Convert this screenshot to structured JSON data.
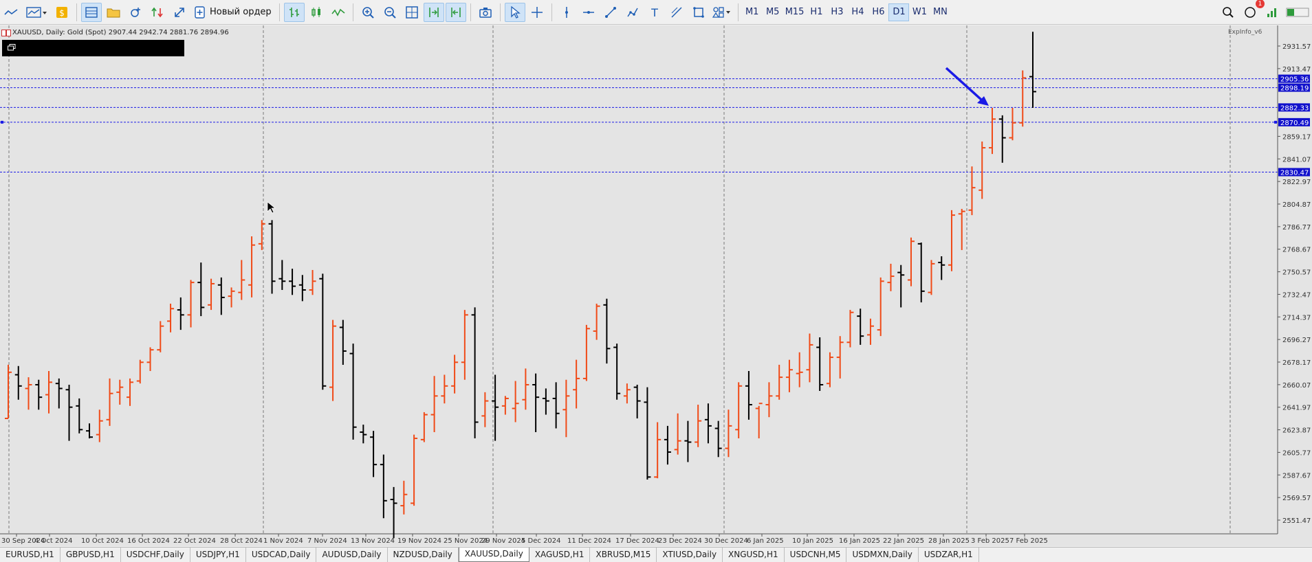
{
  "toolbar": {
    "new_order_label": "Новый ордер",
    "timeframes": [
      "M1",
      "M5",
      "M15",
      "H1",
      "H3",
      "H4",
      "H6",
      "D1",
      "W1",
      "MN"
    ],
    "active_timeframe": "D1",
    "notification_count": "1"
  },
  "chart": {
    "symbol_line": "XAUUSD, Daily:  Gold (Spot)  2907.44 2942.74 2881.76 2894.96",
    "indicator_label": "ExpInfo_v6",
    "colors": {
      "bull": "#f04a17",
      "bear": "#000000",
      "hline": "#1a1ae6",
      "background": "#e4e4e4"
    }
  },
  "chart_data": {
    "type": "ohlc",
    "symbol": "XAUUSD",
    "timeframe": "Daily",
    "ylim": [
      2540,
      2950
    ],
    "price_ticks": [
      "2931.57",
      "2913.47",
      "2859.17",
      "2841.07",
      "2822.97",
      "2804.87",
      "2786.77",
      "2768.67",
      "2750.57",
      "2732.47",
      "2714.37",
      "2696.27",
      "2678.17",
      "2660.07",
      "2641.97",
      "2623.87",
      "2605.77",
      "2587.67",
      "2569.57",
      "2551.47"
    ],
    "date_ticks": [
      "30 Sep 2024",
      "4 Oct 2024",
      "10 Oct 2024",
      "16 Oct 2024",
      "22 Oct 2024",
      "28 Oct 2024",
      "1 Nov 2024",
      "7 Nov 2024",
      "13 Nov 2024",
      "19 Nov 2024",
      "25 Nov 2024",
      "29 Nov 2024",
      "5 Dec 2024",
      "11 Dec 2024",
      "17 Dec 2024",
      "23 Dec 2024",
      "30 Dec 2024",
      "6 Jan 2025",
      "10 Jan 2025",
      "16 Jan 2025",
      "22 Jan 2025",
      "28 Jan 2025",
      "3 Feb 2025",
      "7 Feb 2025"
    ],
    "horizontal_levels": [
      {
        "price": 2905.36,
        "label": "2905.36"
      },
      {
        "price": 2898.19,
        "label": "2898.19"
      },
      {
        "price": 2882.33,
        "label": "2882.33"
      },
      {
        "price": 2870.49,
        "label": "2870.49"
      },
      {
        "price": 2830.47,
        "label": "2830.47"
      }
    ],
    "bars": [
      [
        2633,
        2676,
        2633,
        2670
      ],
      [
        2668,
        2675,
        2648,
        2659
      ],
      [
        2657,
        2666,
        2640,
        2660
      ],
      [
        2660,
        2664,
        2640,
        2650
      ],
      [
        2652,
        2671,
        2637,
        2662
      ],
      [
        2661,
        2665,
        2641,
        2657
      ],
      [
        2656,
        2660,
        2615,
        2642
      ],
      [
        2643,
        2649,
        2621,
        2624
      ],
      [
        2623,
        2629,
        2617,
        2618
      ],
      [
        2620,
        2640,
        2614,
        2631
      ],
      [
        2632,
        2665,
        2627,
        2653
      ],
      [
        2654,
        2664,
        2644,
        2658
      ],
      [
        2650,
        2665,
        2643,
        2662
      ],
      [
        2663,
        2680,
        2661,
        2678
      ],
      [
        2678,
        2690,
        2671,
        2688
      ],
      [
        2688,
        2711,
        2686,
        2707
      ],
      [
        2711,
        2725,
        2702,
        2721
      ],
      [
        2720,
        2730,
        2704,
        2716
      ],
      [
        2716,
        2744,
        2706,
        2742
      ],
      [
        2742,
        2758,
        2715,
        2722
      ],
      [
        2724,
        2745,
        2720,
        2741
      ],
      [
        2740,
        2746,
        2716,
        2730
      ],
      [
        2731,
        2738,
        2722,
        2735
      ],
      [
        2734,
        2760,
        2728,
        2744
      ],
      [
        2740,
        2779,
        2730,
        2772
      ],
      [
        2773,
        2792,
        2768,
        2789
      ],
      [
        2789,
        2792,
        2733,
        2743
      ],
      [
        2745,
        2760,
        2736,
        2743
      ],
      [
        2743,
        2753,
        2732,
        2739
      ],
      [
        2740,
        2748,
        2727,
        2736
      ],
      [
        2736,
        2752,
        2732,
        2743
      ],
      [
        2745,
        2749,
        2656,
        2659
      ],
      [
        2658,
        2712,
        2647,
        2707
      ],
      [
        2706,
        2712,
        2676,
        2687
      ],
      [
        2685,
        2693,
        2616,
        2626
      ],
      [
        2622,
        2628,
        2613,
        2620
      ],
      [
        2618,
        2623,
        2586,
        2596
      ],
      [
        2596,
        2604,
        2553,
        2567
      ],
      [
        2568,
        2578,
        2537,
        2565
      ],
      [
        2563,
        2583,
        2556,
        2572
      ],
      [
        2565,
        2620,
        2563,
        2617
      ],
      [
        2616,
        2638,
        2614,
        2636
      ],
      [
        2636,
        2667,
        2622,
        2651
      ],
      [
        2651,
        2668,
        2645,
        2659
      ],
      [
        2659,
        2684,
        2653,
        2678
      ],
      [
        2678,
        2720,
        2664,
        2716
      ],
      [
        2716,
        2722,
        2617,
        2630
      ],
      [
        2635,
        2654,
        2626,
        2647
      ],
      [
        2647,
        2668,
        2615,
        2642
      ],
      [
        2643,
        2651,
        2636,
        2649
      ],
      [
        2641,
        2663,
        2630,
        2645
      ],
      [
        2648,
        2673,
        2640,
        2660
      ],
      [
        2660,
        2669,
        2622,
        2650
      ],
      [
        2649,
        2657,
        2636,
        2647
      ],
      [
        2649,
        2662,
        2625,
        2637
      ],
      [
        2640,
        2664,
        2618,
        2651
      ],
      [
        2656,
        2680,
        2641,
        2665
      ],
      [
        2665,
        2708,
        2663,
        2705
      ],
      [
        2703,
        2725,
        2696,
        2723
      ],
      [
        2724,
        2729,
        2677,
        2689
      ],
      [
        2690,
        2693,
        2648,
        2653
      ],
      [
        2651,
        2661,
        2645,
        2656
      ],
      [
        2658,
        2660,
        2633,
        2647
      ],
      [
        2646,
        2658,
        2584,
        2586
      ],
      [
        2586,
        2630,
        2585,
        2616
      ],
      [
        2616,
        2627,
        2596,
        2606
      ],
      [
        2608,
        2637,
        2604,
        2615
      ],
      [
        2615,
        2631,
        2598,
        2614
      ],
      [
        2614,
        2644,
        2610,
        2631
      ],
      [
        2632,
        2645,
        2613,
        2627
      ],
      [
        2625,
        2631,
        2602,
        2609
      ],
      [
        2609,
        2640,
        2602,
        2627
      ],
      [
        2624,
        2662,
        2617,
        2659
      ],
      [
        2659,
        2671,
        2632,
        2644
      ],
      [
        2641,
        2643,
        2617,
        2645
      ],
      [
        2644,
        2662,
        2634,
        2651
      ],
      [
        2651,
        2676,
        2648,
        2666
      ],
      [
        2666,
        2680,
        2654,
        2672
      ],
      [
        2669,
        2686,
        2658,
        2670
      ],
      [
        2672,
        2701,
        2662,
        2692
      ],
      [
        2690,
        2698,
        2655,
        2660
      ],
      [
        2661,
        2686,
        2658,
        2682
      ],
      [
        2682,
        2699,
        2665,
        2694
      ],
      [
        2694,
        2720,
        2690,
        2718
      ],
      [
        2715,
        2721,
        2692,
        2699
      ],
      [
        2700,
        2713,
        2692,
        2707
      ],
      [
        2704,
        2746,
        2699,
        2743
      ],
      [
        2742,
        2757,
        2735,
        2747
      ],
      [
        2750,
        2756,
        2722,
        2748
      ],
      [
        2744,
        2778,
        2739,
        2775
      ],
      [
        2773,
        2774,
        2726,
        2735
      ],
      [
        2734,
        2760,
        2732,
        2757
      ],
      [
        2758,
        2763,
        2744,
        2756
      ],
      [
        2756,
        2800,
        2751,
        2796
      ],
      [
        2797,
        2801,
        2768,
        2799
      ],
      [
        2800,
        2835,
        2796,
        2818
      ],
      [
        2816,
        2855,
        2809,
        2850
      ],
      [
        2850,
        2882,
        2845,
        2873
      ],
      [
        2873,
        2876,
        2838,
        2858
      ],
      [
        2858,
        2882,
        2856,
        2870
      ],
      [
        2870,
        2912,
        2867,
        2906
      ],
      [
        2907,
        2943,
        2882,
        2895
      ]
    ]
  }
}
